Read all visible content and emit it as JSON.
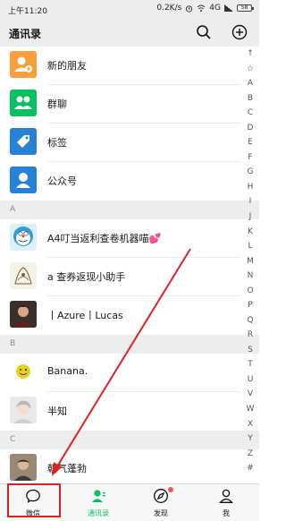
{
  "status_bar": {
    "time": "上午11:20",
    "speed": "0.2K/s",
    "network": "4G",
    "battery": "58"
  },
  "header": {
    "title": "通讯录"
  },
  "top_items": [
    {
      "label": "新的朋友",
      "icon": "new-friends-icon",
      "color": "#fa9d3b"
    },
    {
      "label": "群聊",
      "icon": "group-chat-icon",
      "color": "#07c160"
    },
    {
      "label": "标签",
      "icon": "tag-icon",
      "color": "#2782d7"
    },
    {
      "label": "公众号",
      "icon": "official-account-icon",
      "color": "#2782d7"
    }
  ],
  "sections": [
    {
      "letter": "A",
      "contacts": [
        "A4叮当返利查卷机器喵💕",
        "a   查券返现小助手",
        "丨Azure丨Lucas"
      ]
    },
    {
      "letter": "B",
      "contacts": [
        "Banana.",
        "半知"
      ]
    },
    {
      "letter": "C",
      "contacts": [
        "朝气蓬勃"
      ]
    }
  ],
  "index_letters": [
    "↑",
    "☆",
    "A",
    "B",
    "C",
    "D",
    "E",
    "F",
    "G",
    "H",
    "I",
    "J",
    "K",
    "L",
    "M",
    "N",
    "O",
    "P",
    "Q",
    "R",
    "S",
    "T",
    "U",
    "V",
    "W",
    "X",
    "Y",
    "Z",
    "#"
  ],
  "tabs": [
    {
      "label": "微信",
      "icon": "chat-icon"
    },
    {
      "label": "通讯录",
      "icon": "contacts-icon"
    },
    {
      "label": "发现",
      "icon": "discover-icon"
    },
    {
      "label": "我",
      "icon": "me-icon"
    }
  ],
  "colors": {
    "accent": "#07c160",
    "annotation": "#e02020",
    "header_bg": "#ededed"
  }
}
